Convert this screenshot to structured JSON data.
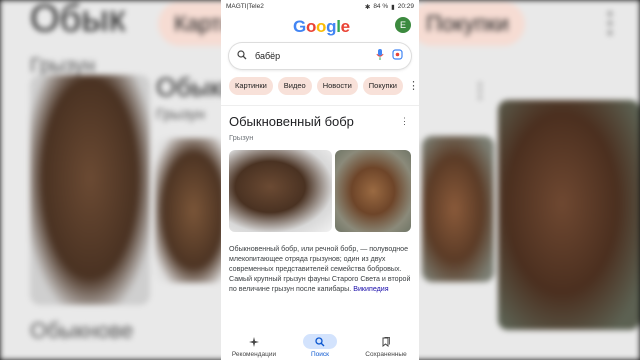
{
  "status_bar": {
    "carrier": "MAGTI|Tele2",
    "battery": "84 %",
    "time": "20:29"
  },
  "header": {
    "logo_letters": [
      "G",
      "o",
      "o",
      "g",
      "l",
      "e"
    ],
    "avatar_letter": "E"
  },
  "search": {
    "query": "бабёр",
    "icons": [
      "search-icon",
      "mic-icon",
      "lens-icon"
    ]
  },
  "chips": [
    "Картинки",
    "Видео",
    "Новости",
    "Покупки"
  ],
  "knowledge_panel": {
    "title": "Обыкновенный бобр",
    "subtitle": "Грызун",
    "description": "Обыкновенный бобр, или речной бобр, — полуводное млекопитающее отряда грызунов; один из двух современных представителей семейства бобровых. Самый крупный грызун фауны Старого Света и второй по величине грызун после капибары.",
    "source_link": "Википедия"
  },
  "bottom_nav": [
    {
      "label": "Рекомендации",
      "icon": "sparkle-icon",
      "active": false
    },
    {
      "label": "Поиск",
      "icon": "search-icon",
      "active": true
    },
    {
      "label": "Сохраненные",
      "icon": "bookmarks-icon",
      "active": false
    }
  ],
  "background": {
    "chips": [
      "Картинки",
      "Покупки"
    ],
    "title_fragment": "Обык",
    "title_fragment_2": "Обыкн",
    "subtitle": "Грызун",
    "text_fragment": "Обыкнове"
  },
  "colors": {
    "chip_bg": "#f8e1d9",
    "active_nav": "#d3e3fd",
    "link": "#1a0dab"
  }
}
